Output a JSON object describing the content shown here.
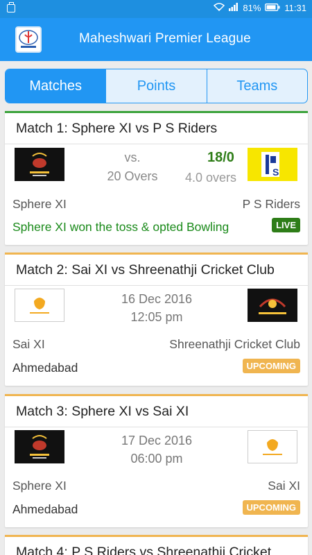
{
  "status_bar": {
    "battery": "81%",
    "time": "11:31"
  },
  "app": {
    "title": "Maheshwari Premier League",
    "logo_icon": "mpl-logo-icon"
  },
  "tabs": [
    {
      "label": "Matches",
      "active": true
    },
    {
      "label": "Points",
      "active": false
    },
    {
      "label": "Teams",
      "active": false
    }
  ],
  "colors": {
    "primary": "#2196f3",
    "live": "#2e7d18",
    "upcoming": "#f0b550",
    "win_text": "#1a8a1a"
  },
  "matches": [
    {
      "title": "Match 1: Sphere XI vs P S Riders",
      "vs": "vs.",
      "overs_total": "20 Overs",
      "score": "18/0",
      "overs_played": "4.0 overs",
      "team1": "Sphere XI",
      "team2": "P S Riders",
      "status": "Sphere XI won the toss & opted Bowling",
      "badge": "LIVE"
    },
    {
      "title": "Match 2: Sai XI vs Shreenathji Cricket Club",
      "date": "16 Dec 2016",
      "time": "12:05 pm",
      "team1": "Sai XI",
      "team2": "Shreenathji Cricket Club",
      "venue": "Ahmedabad",
      "badge": "UPCOMING"
    },
    {
      "title": "Match 3: Sphere XI vs Sai XI",
      "date": "17 Dec 2016",
      "time": "06:00 pm",
      "team1": "Sphere XI",
      "team2": "Sai XI",
      "venue": "Ahmedabad",
      "badge": "UPCOMING"
    },
    {
      "title": "Match 4: P S Riders vs Shreenathji Cricket"
    }
  ]
}
